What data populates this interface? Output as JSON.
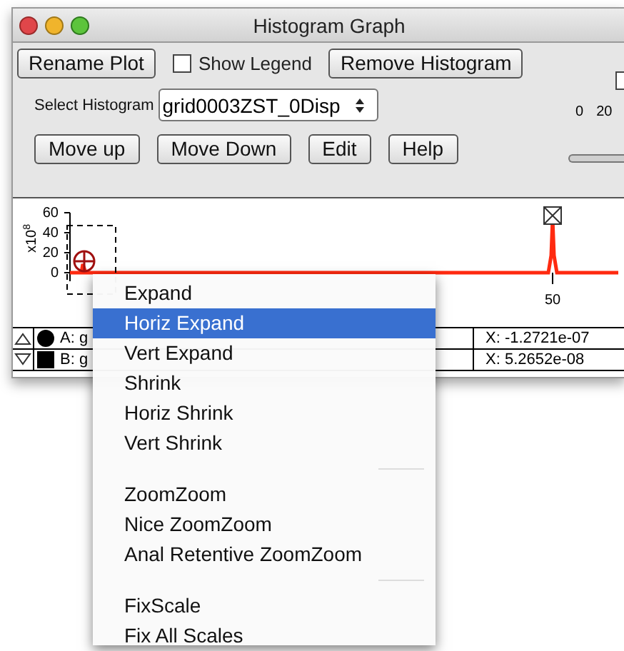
{
  "window": {
    "title": "Histogram Graph"
  },
  "toolbar": {
    "rename_button": "Rename Plot",
    "show_legend": {
      "label": "Show Legend",
      "checked": false
    },
    "remove_button": "Remove Histogram"
  },
  "select_histogram": {
    "label": "Select Histogram",
    "value": "grid0003ZST_0Disp"
  },
  "buttons": [
    "Move up",
    "Move Down",
    "Edit",
    "Help"
  ],
  "side": {
    "checked": false,
    "scale_labels": [
      "0",
      "20"
    ]
  },
  "plot": {
    "y_unit": {
      "base": "x10",
      "exponent": "8"
    },
    "y_ticks": [
      "60",
      "40",
      "20",
      "0"
    ],
    "x_ticks": [
      "50"
    ]
  },
  "legend": [
    {
      "name": "A: g",
      "kind": "circle",
      "readout": "X: -1.2721e-07"
    },
    {
      "name": "B: g",
      "kind": "square",
      "readout": "X: 5.2652e-08"
    }
  ],
  "menu": {
    "items": [
      {
        "kind": "item",
        "label": "Expand",
        "selected": false
      },
      {
        "kind": "item",
        "label": "Horiz Expand",
        "selected": true
      },
      {
        "kind": "item",
        "label": "Vert Expand",
        "selected": false
      },
      {
        "kind": "item",
        "label": "Shrink",
        "selected": false
      },
      {
        "kind": "item",
        "label": "Horiz Shrink",
        "selected": false
      },
      {
        "kind": "item",
        "label": "Vert Shrink",
        "selected": false
      },
      {
        "kind": "separator"
      },
      {
        "kind": "item",
        "label": "ZoomZoom",
        "selected": false
      },
      {
        "kind": "item",
        "label": "Nice ZoomZoom",
        "selected": false
      },
      {
        "kind": "item",
        "label": "Anal Retentive ZoomZoom",
        "selected": false
      },
      {
        "kind": "separator"
      },
      {
        "kind": "item",
        "label": "FixScale",
        "selected": false
      },
      {
        "kind": "item",
        "label": "Fix All Scales",
        "selected": false
      }
    ]
  }
}
